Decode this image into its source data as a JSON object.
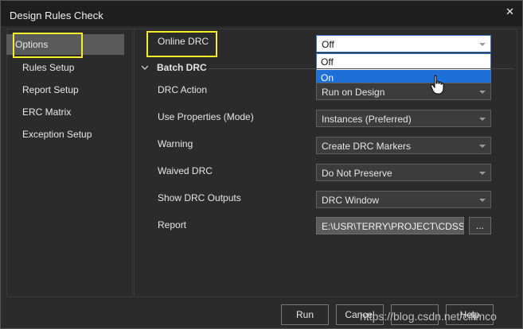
{
  "window": {
    "title": "Design Rules Check",
    "close_glyph": "✕"
  },
  "sidebar": {
    "items": [
      {
        "label": "Options",
        "selected": true
      },
      {
        "label": "Rules Setup"
      },
      {
        "label": "Report Setup"
      },
      {
        "label": "ERC Matrix"
      },
      {
        "label": "Exception Setup"
      }
    ]
  },
  "online_drc": {
    "label": "Online DRC",
    "value": "Off",
    "dropdown_open": true,
    "options": [
      "Off",
      "On"
    ],
    "highlighted_option": "On"
  },
  "batch_drc": {
    "section_label": "Batch DRC",
    "fields": [
      {
        "label": "DRC Action",
        "value": "Run on Design"
      },
      {
        "label": "Use Properties (Mode)",
        "value": "Instances (Preferred)"
      },
      {
        "label": "Warning",
        "value": "Create DRC Markers"
      },
      {
        "label": "Waived DRC",
        "value": "Do Not Preserve"
      },
      {
        "label": "Show DRC Outputs",
        "value": "DRC Window"
      }
    ],
    "report": {
      "label": "Report",
      "path": "E:\\USR\\TERRY\\PROJECT\\CDSS",
      "browse_label": "..."
    }
  },
  "buttons": {
    "run": "Run",
    "cancel": "Cancel",
    "help": "Help"
  },
  "watermark": "https://blog.csdn.net/cilimco",
  "colors": {
    "highlight_box": "#f3ef2b",
    "selection": "#1e6fd6",
    "background": "#2b2b2b"
  },
  "icons": [
    "close-icon",
    "chevron-down-icon",
    "dropdown-arrow-icon",
    "hand-cursor-icon"
  ]
}
